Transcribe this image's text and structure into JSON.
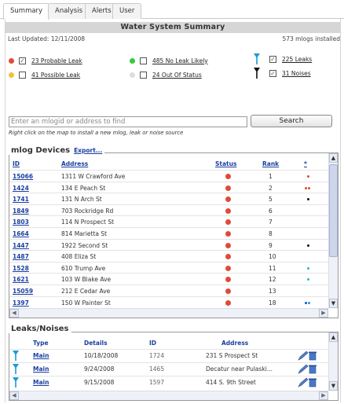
{
  "tabs": [
    "Summary",
    "Analysis",
    "Alerts",
    "User"
  ],
  "panel": {
    "title": "Water System Summary",
    "last_updated": "Last Updated: 12/11/2008",
    "installed": "573 mlogs installed"
  },
  "filters": {
    "probable_leak": "23 Probable Leak",
    "possible_leak": "41 Possible Leak",
    "no_leak": "485 No Leak Likely",
    "out_of_status": "24 Out Of Status",
    "leaks": "225 Leaks",
    "noises": "31 Noises"
  },
  "search": {
    "placeholder": "Enter an mlogid or address to find",
    "button": "Search",
    "hint": "Right click on the map to install a new mlog, leak or noise source"
  },
  "devices": {
    "heading": "mlog Devices",
    "export": "Export...",
    "headers": {
      "id": "ID",
      "address": "Address",
      "status": "Status",
      "rank": "Rank",
      "star": "*"
    },
    "rows": [
      {
        "id": "15066",
        "address": "1311 W Crawford Ave",
        "rank": "1"
      },
      {
        "id": "1424",
        "address": "134 E Peach St",
        "rank": "2"
      },
      {
        "id": "1741",
        "address": "131 N Arch St",
        "rank": "5"
      },
      {
        "id": "1849",
        "address": "703 Rockridge Rd",
        "rank": "6"
      },
      {
        "id": "1803",
        "address": "114 N Prospect St",
        "rank": "7"
      },
      {
        "id": "1664",
        "address": "814 Marietta St",
        "rank": "8"
      },
      {
        "id": "1447",
        "address": "1922 Second St",
        "rank": "9"
      },
      {
        "id": "1487",
        "address": "408 Eliza St",
        "rank": "10"
      },
      {
        "id": "1528",
        "address": "610 Trump Ave",
        "rank": "11"
      },
      {
        "id": "1621",
        "address": "103 W Blake Ave",
        "rank": "12"
      },
      {
        "id": "15059",
        "address": "212 E Cedar Ave",
        "rank": "13"
      },
      {
        "id": "1397",
        "address": "150 W Painter St",
        "rank": "18"
      }
    ]
  },
  "leaks": {
    "heading": "Leaks/Noises",
    "headers": {
      "type": "Type",
      "details": "Details",
      "id": "ID",
      "address": "Address"
    },
    "rows": [
      {
        "type": "Main",
        "details": "10/18/2008",
        "id": "1724",
        "address": "231 S Prospect St"
      },
      {
        "type": "Main",
        "details": "9/24/2008",
        "id": "1465",
        "address": "Decatur near Pulaski..."
      },
      {
        "type": "Main",
        "details": "9/15/2008",
        "id": "1597",
        "address": "414 S. 9th Street"
      }
    ]
  },
  "colors": {
    "probable": "#e04a3a",
    "possible": "#f0c23a",
    "no_leak": "#33cc33",
    "out_of_status": "#dddddd",
    "leak_pin": "#1a9ad6",
    "noise_pin": "#111111",
    "link": "#1a3fa0"
  }
}
